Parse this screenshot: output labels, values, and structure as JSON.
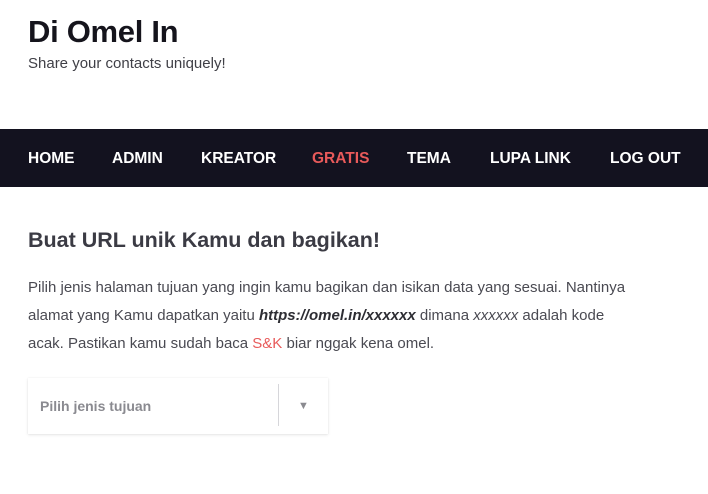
{
  "site": {
    "title": "Di Omel In",
    "tagline": "Share your contacts uniquely!"
  },
  "nav": {
    "items": [
      {
        "label": "HOME",
        "active": false
      },
      {
        "label": "ADMIN",
        "active": false
      },
      {
        "label": "KREATOR",
        "active": false
      },
      {
        "label": "GRATIS",
        "active": true
      },
      {
        "label": "TEMA",
        "active": false
      },
      {
        "label": "LUPA LINK",
        "active": false
      },
      {
        "label": "LOG OUT",
        "active": false
      }
    ]
  },
  "main": {
    "heading": "Buat URL unik Kamu dan bagikan!",
    "intro_part1": "Pilih jenis halaman tujuan yang ingin kamu bagikan dan isikan data yang sesuai. Nantinya alamat yang Kamu dapatkan yaitu ",
    "intro_url": "https://omel.in/xxxxxx",
    "intro_part2": " dimana ",
    "intro_code": "xxxxxx",
    "intro_part3": " adalah kode acak. Pastikan kamu sudah baca ",
    "intro_link": "S&K",
    "intro_part4": " biar nggak kena omel.",
    "select_placeholder": "Pilih jenis tujuan",
    "select_arrow": "▼"
  },
  "colors": {
    "nav_bg": "#13121f",
    "accent": "#e85a5a",
    "title": "#15141c"
  }
}
